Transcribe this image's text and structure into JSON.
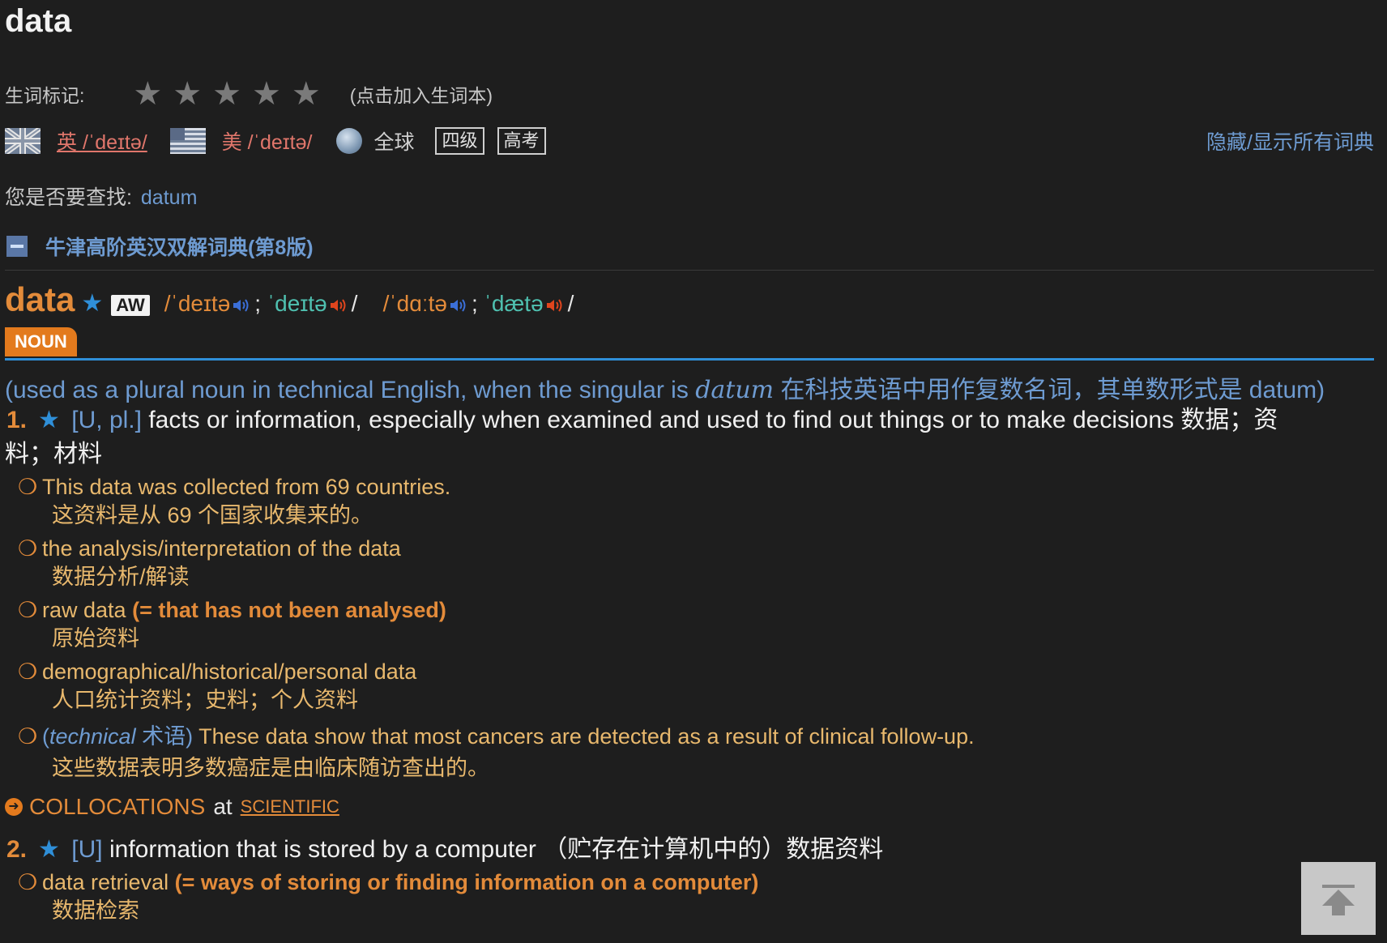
{
  "header": {
    "word": "data"
  },
  "wordbook": {
    "label": "生词标记:",
    "stars": 5,
    "add_hint": "(点击加入生词本)"
  },
  "pronunciation": {
    "uk": "英 /ˈdeɪtə/",
    "us": "美 /ˈdeɪtə/",
    "global": "全球",
    "tags": [
      "四级",
      "高考"
    ],
    "toggle_all": "隐藏/显示所有词典"
  },
  "suggestion": {
    "label": "您是否要查找:",
    "word": "datum"
  },
  "dictionary": {
    "title": "牛津高阶英汉双解词典(第8版)",
    "entry": {
      "word": "data",
      "badge": "AW",
      "phonetics": [
        {
          "text": "/ˈdeɪtə",
          "color": "orange"
        },
        {
          "text": "; ",
          "color": "white"
        },
        {
          "text": "ˈdeɪtə",
          "color": "teal"
        },
        {
          "text": "/",
          "color": "white"
        },
        {
          "text": "/ˈdɑːtə",
          "color": "orange"
        },
        {
          "text": "; ",
          "color": "white"
        },
        {
          "text": "ˈdætə",
          "color": "teal"
        },
        {
          "text": "/",
          "color": "white"
        }
      ],
      "pos": "NOUN",
      "usage_note_before": "(used as a plural noun in technical English, when the singular is ",
      "usage_note_italic": "datum",
      "usage_note_after": " 在科技英语中用作复数名词，其单数形式是 datum)",
      "senses": [
        {
          "number": "1.",
          "grammar": "[U, pl.]",
          "definition": "facts or information, especially when examined and used to find out things or to make decisions 数据；资",
          "definition_cont": "料；材料",
          "examples": [
            {
              "en": "This data was collected from 69 countries.",
              "zh": "这资料是从 69 个国家收集来的。"
            },
            {
              "en": "the analysis/interpretation of the data",
              "zh": "数据分析/解读"
            },
            {
              "en": "raw data",
              "note": "(= that has not been analysed)",
              "zh": "原始资料"
            },
            {
              "en": "demographical/historical/personal data",
              "zh": "人口统计资料；史料；个人资料"
            },
            {
              "register": "technical",
              "register_zh": "术语",
              "en": "These data show that most cancers are detected as a result of clinical follow-up.",
              "zh": "这些数据表明多数癌症是由临床随访查出的。"
            }
          ]
        },
        {
          "number": "2.",
          "grammar": "[U]",
          "definition": "information that is stored by a computer （贮存在计算机中的）数据资料",
          "examples": [
            {
              "en": "data retrieval",
              "note": "(= ways of storing or finding information on a computer)",
              "zh": "数据检索"
            }
          ]
        }
      ],
      "collocations": {
        "label": "COLLOCATIONS",
        "at": "at",
        "link": "SCIENTIFIC"
      }
    }
  },
  "colors": {
    "background": "#1e1e1e",
    "accent_orange": "#e38b3a",
    "link_blue": "#6e9bd1",
    "example_text": "#e8b86d",
    "pos_line": "#2f8fd8"
  }
}
